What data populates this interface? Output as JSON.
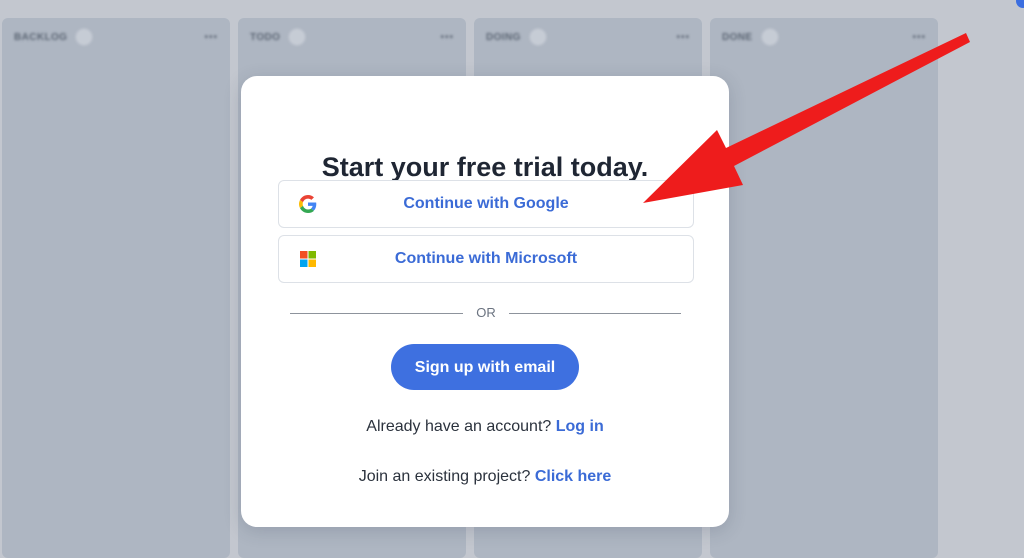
{
  "board": {
    "columns": [
      {
        "title": "BACKLOG"
      },
      {
        "title": "TODO"
      },
      {
        "title": "DOING"
      },
      {
        "title": "DONE"
      }
    ],
    "more_glyph": "•••"
  },
  "modal": {
    "title": "Start your free trial today.",
    "google_label": "Continue with Google",
    "microsoft_label": "Continue with Microsoft",
    "or_label": "OR",
    "email_label": "Sign up with email",
    "login_prompt": "Already have an account?",
    "login_link": "Log in",
    "join_prompt": "Join an existing project?",
    "join_link": "Click here"
  },
  "icons": {
    "google": "google-g-icon",
    "microsoft": "microsoft-logo-icon",
    "annotation": "red-arrow"
  },
  "colors": {
    "link": "#3b6bd6",
    "primary_button": "#3e70e0",
    "arrow": "#ee1c1c",
    "overlay": "#c3c7cf"
  }
}
